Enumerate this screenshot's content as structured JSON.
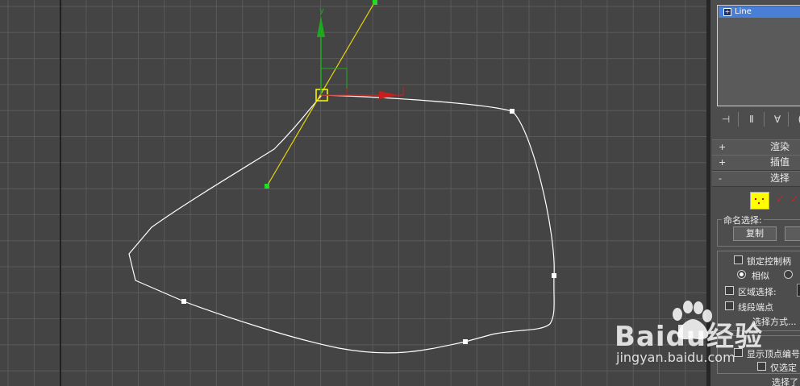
{
  "viewport": {
    "axis_label_y": "y"
  },
  "panel": {
    "modifier_list": {
      "item": "Line",
      "item_icon": "plus-box-icon"
    },
    "rollouts": {
      "render": {
        "toggle": "+",
        "title": "渲染"
      },
      "interpolation": {
        "toggle": "+",
        "title": "插值"
      },
      "selection": {
        "toggle": "-",
        "title": "选择"
      }
    },
    "named_selection": {
      "label": "命名选择:",
      "copy_button": "复制"
    },
    "options": {
      "lock_handles": "锁定控制柄",
      "similar": "相似",
      "area_select": "区域选择:",
      "segment_end": "线段端点",
      "select_by": "选择方式...",
      "show_vertex_numbers": "显示顶点编号",
      "selected_only": "仅选定",
      "selected_status": "选择了"
    }
  },
  "watermark": {
    "brand": "Baidu经验",
    "url": "jingyan.baidu.com"
  },
  "colors": {
    "viewport_bg": "#444444",
    "grid": "#5a5a5a",
    "spline": "#ffffff",
    "tangent": "#e8d60a",
    "handle": "#22dd22",
    "axis_y": "#1fa81f",
    "axis_x": "#c81e1e",
    "selection_highlight": "#ffff00",
    "list_selected": "#4a7fd8"
  }
}
